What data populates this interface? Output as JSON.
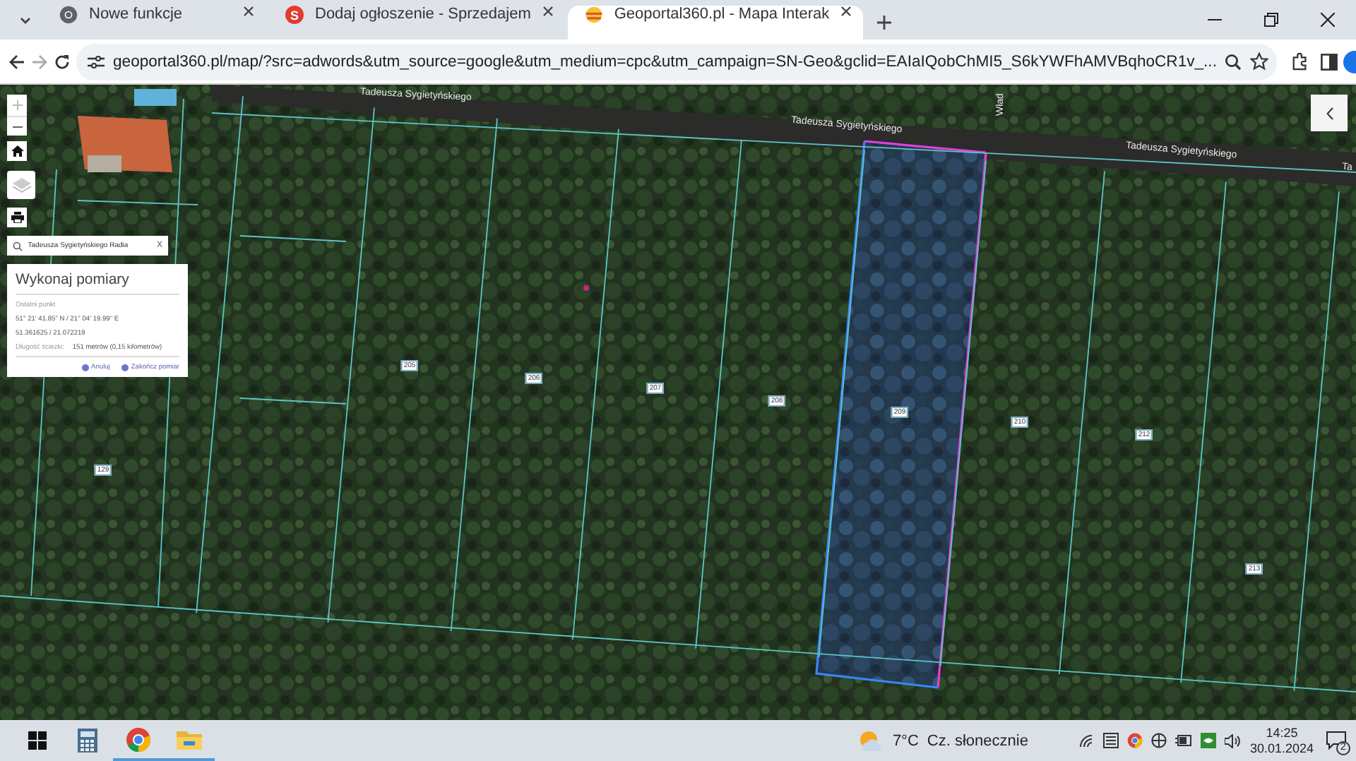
{
  "browser": {
    "tabs": [
      {
        "title": "Nowe funkcje",
        "selected": false,
        "kind": "chrome"
      },
      {
        "title": "Dodaj ogłoszenie - Sprzedajem",
        "selected": false,
        "kind": "letter",
        "badge": "S"
      },
      {
        "title": "Geoportal360.pl - Mapa Interak",
        "selected": true,
        "kind": "geoportal"
      }
    ],
    "url": "geoportal360.pl/map/?src=adwords&utm_source=google&utm_medium=cpc&utm_campaign=SN-Geo&gclid=EAIaIQobChMI5_S6kYWFhAMVBqhoCR1v_..."
  },
  "map": {
    "search": {
      "value": "Tadeusza Sygietyńskiego Radia",
      "clear": "X"
    },
    "roads": [
      {
        "name": "Tadeusza Sygietyńskiego"
      },
      {
        "name": "Tadeusza Sygietyńskiego"
      },
      {
        "name": "Tadeusza Sygietyńskiego"
      },
      {
        "name": "Ta"
      },
      {
        "name": "Wład"
      }
    ],
    "parcels": [
      {
        "number": "129"
      },
      {
        "number": "205"
      },
      {
        "number": "206"
      },
      {
        "number": "207"
      },
      {
        "number": "208"
      },
      {
        "number": "209",
        "selected": true
      },
      {
        "number": "210"
      },
      {
        "number": "212"
      },
      {
        "number": "213"
      }
    ],
    "measure_panel": {
      "title": "Wykonaj pomiary",
      "last_point_label": "Ostatni punkt",
      "dms": "51° 21' 41.85\" N / 21° 04' 19.99\" E",
      "decimal": "51.361625 / 21.072219",
      "length_label": "Długość ścieżki:",
      "length_value": "151 metrów (0,15 kilometrów)",
      "buttons": [
        "Anuluj",
        "Zakończ pomiar"
      ]
    }
  },
  "taskbar": {
    "weather": {
      "temp": "7°C",
      "condition": "Cz. słonecznie"
    },
    "time": "14:25",
    "date": "30.01.2024",
    "notifications": "2",
    "apps": [
      {
        "kind": "calculator",
        "active": false
      },
      {
        "kind": "chrome",
        "active": true
      },
      {
        "kind": "files",
        "active": true
      }
    ]
  }
}
